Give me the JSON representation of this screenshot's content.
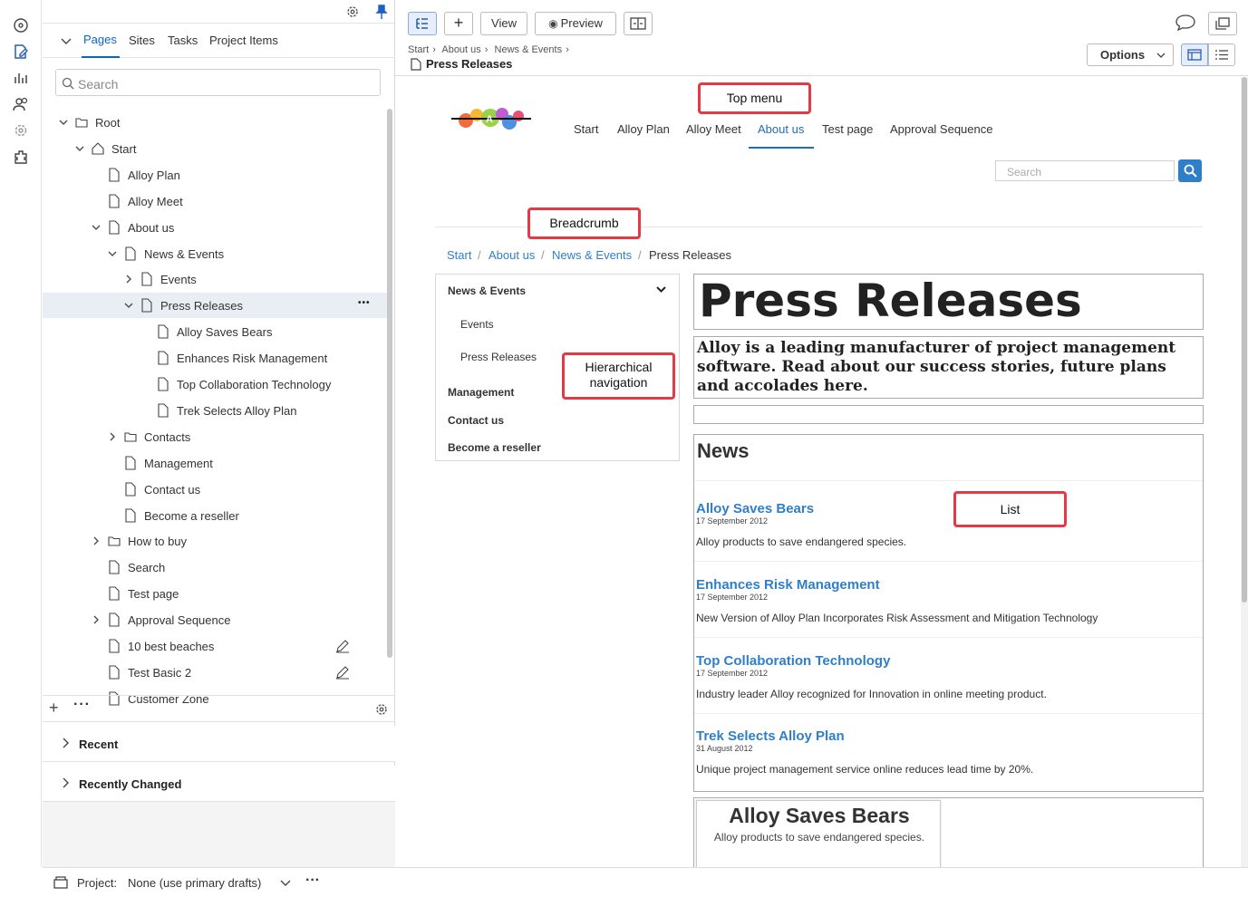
{
  "rail": {
    "icons": [
      "compass-icon",
      "edit-pages-icon",
      "reports-icon",
      "users-icon",
      "settings-icon",
      "addons-icon"
    ]
  },
  "tree": {
    "tabs": [
      {
        "label": "Pages"
      },
      {
        "label": "Sites"
      },
      {
        "label": "Tasks"
      },
      {
        "label": "Project Items"
      }
    ],
    "search_placeholder": "Search",
    "rows": [
      {
        "label": "Root"
      },
      {
        "label": "Start"
      },
      {
        "label": "Alloy Plan"
      },
      {
        "label": "Alloy Meet"
      },
      {
        "label": "About us"
      },
      {
        "label": "News & Events"
      },
      {
        "label": "Events"
      },
      {
        "label": "Press Releases"
      },
      {
        "label": "Alloy Saves Bears"
      },
      {
        "label": "Enhances Risk Management"
      },
      {
        "label": "Top Collaboration Technology"
      },
      {
        "label": "Trek Selects Alloy Plan"
      },
      {
        "label": "Contacts"
      },
      {
        "label": "Management"
      },
      {
        "label": "Contact us"
      },
      {
        "label": "Become a reseller"
      },
      {
        "label": "How to buy"
      },
      {
        "label": "Search"
      },
      {
        "label": "Test page"
      },
      {
        "label": "Approval Sequence"
      },
      {
        "label": "10 best beaches"
      },
      {
        "label": "Test Basic 2"
      },
      {
        "label": "Customer Zone"
      }
    ],
    "recent_label": "Recent",
    "recently_changed_label": "Recently Changed"
  },
  "footer": {
    "project_label": "Project:",
    "project_value": "None (use primary drafts)"
  },
  "toolbar": {
    "view_label": "View",
    "preview_label": "Preview",
    "options_label": "Options",
    "breadcrumb": [
      "Start",
      "About us",
      "News & Events"
    ],
    "title": "Press Releases"
  },
  "site": {
    "nav": [
      "Start",
      "Alloy Plan",
      "Alloy Meet",
      "About us",
      "Test page",
      "Approval Sequence"
    ],
    "search_placeholder": "Search",
    "breadcrumb": [
      "Start",
      "About us",
      "News & Events",
      "Press Releases"
    ],
    "subnav": {
      "heading": "News & Events",
      "children": [
        "Events",
        "Press Releases"
      ],
      "siblings": [
        "Management",
        "Contact us",
        "Become a reseller"
      ]
    },
    "page_title": "Press Releases",
    "intro": "Alloy is a leading manufacturer of project management software. Read about our success stories, future plans and accolades here.",
    "news_heading": "News",
    "news": [
      {
        "title": "Alloy Saves Bears",
        "date": "17 September 2012",
        "desc": "Alloy products to save endangered species."
      },
      {
        "title": "Enhances Risk Management",
        "date": "17 September 2012",
        "desc": "New Version of Alloy Plan Incorporates Risk Assessment and Mitigation Technology"
      },
      {
        "title": "Top Collaboration Technology",
        "date": "17 September 2012",
        "desc": "Industry leader Alloy recognized for Innovation in online meeting product."
      },
      {
        "title": "Trek Selects Alloy Plan",
        "date": "31 August 2012",
        "desc": "Unique project management service online reduces lead time by 20%."
      }
    ],
    "teaser": {
      "title": "Alloy Saves Bears",
      "desc": "Alloy products to save endangered species."
    }
  },
  "annotations": {
    "top_menu": "Top menu",
    "breadcrumb": "Breadcrumb",
    "hier_nav_line1": "Hierarchical",
    "hier_nav_line2": "navigation",
    "list": "List"
  },
  "colors": {
    "accent": "#0b66c3",
    "link": "#2f7fc8",
    "annotation": "#e53946"
  }
}
